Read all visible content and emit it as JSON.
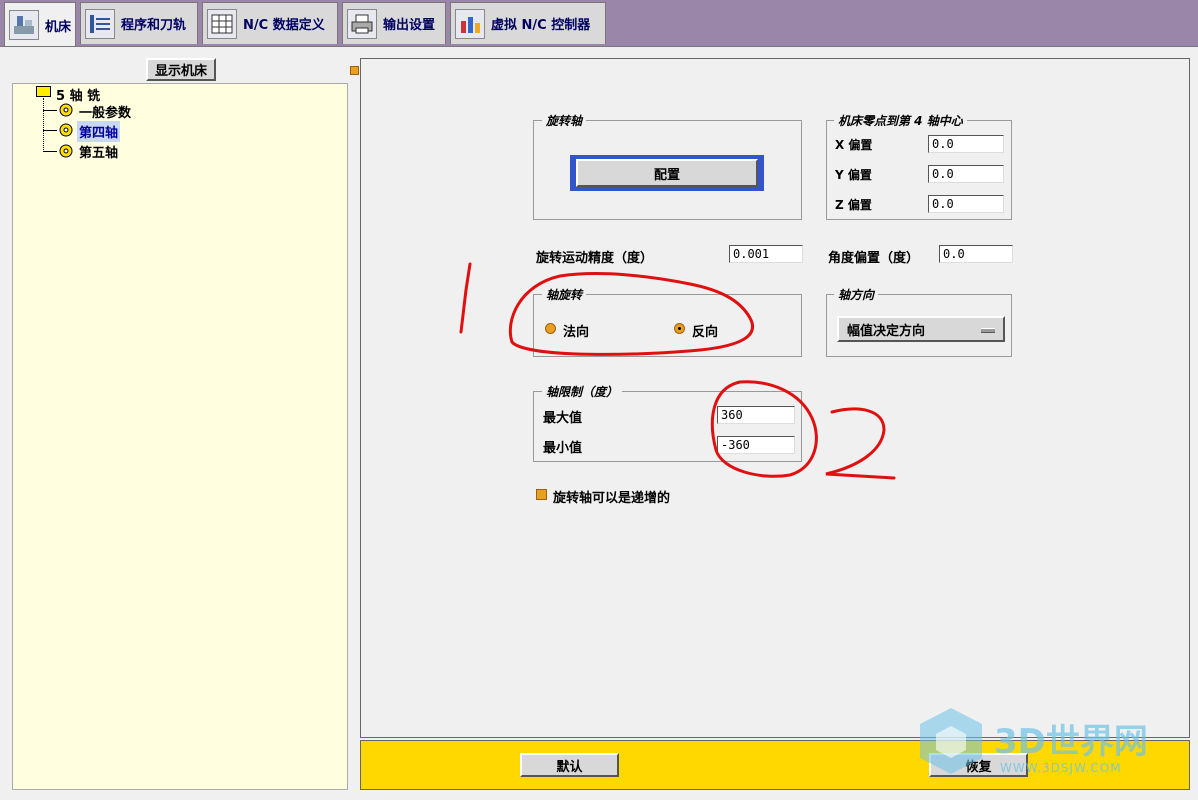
{
  "tabs": [
    {
      "label": "机床",
      "icon": "machine-icon",
      "active": true
    },
    {
      "label": "程序和刀轨",
      "icon": "program-toolpath-icon",
      "active": false
    },
    {
      "label": "N/C 数据定义",
      "icon": "nc-data-icon",
      "active": false
    },
    {
      "label": "输出设置",
      "icon": "printer-icon",
      "active": false
    },
    {
      "label": "虚拟 N/C 控制器",
      "icon": "virtual-controller-icon",
      "active": false
    }
  ],
  "left": {
    "show_machine_button": "显示机床",
    "tree": {
      "root": "5 轴 铣",
      "items": [
        "一般参数",
        "第四轴",
        "第五轴"
      ],
      "selected": "第四轴"
    }
  },
  "rotary_axis": {
    "legend": "旋转轴",
    "config_button": "配置"
  },
  "machine_zero": {
    "legend": "机床零点到第 4 轴中心",
    "x_label": "X 偏置",
    "x_value": "0.0",
    "y_label": "Y 偏置",
    "y_value": "0.0",
    "z_label": "Z 偏置",
    "z_value": "0.0"
  },
  "precision": {
    "label": "旋转运动精度（度）",
    "value": "0.001"
  },
  "angle_offset": {
    "label": "角度偏置（度）",
    "value": "0.0"
  },
  "axis_rotation": {
    "legend": "轴旋转",
    "option_normal": "法向",
    "option_reverse": "反向",
    "selected": "反向"
  },
  "axis_direction": {
    "legend": "轴方向",
    "value": "幅值决定方向"
  },
  "axis_limits": {
    "legend": "轴限制（度）",
    "max_label": "最大值",
    "max_value": "360",
    "min_label": "最小值",
    "min_value": "-360"
  },
  "incremental_checkbox": {
    "label": "旋转轴可以是递增的",
    "checked": true
  },
  "bottom": {
    "default_button": "默认",
    "restore_button": "恢复"
  },
  "annotations": [
    "1",
    "2"
  ],
  "watermark": {
    "text": "3D世界网",
    "url": "WWW.3DSJW.COM"
  },
  "colors": {
    "tab_bar": "#9a86a8",
    "tree_bg": "#ffffe0",
    "bottom_bar": "#ffd800",
    "annotation_red": "#e01010",
    "config_button_border": "#3355cc"
  }
}
